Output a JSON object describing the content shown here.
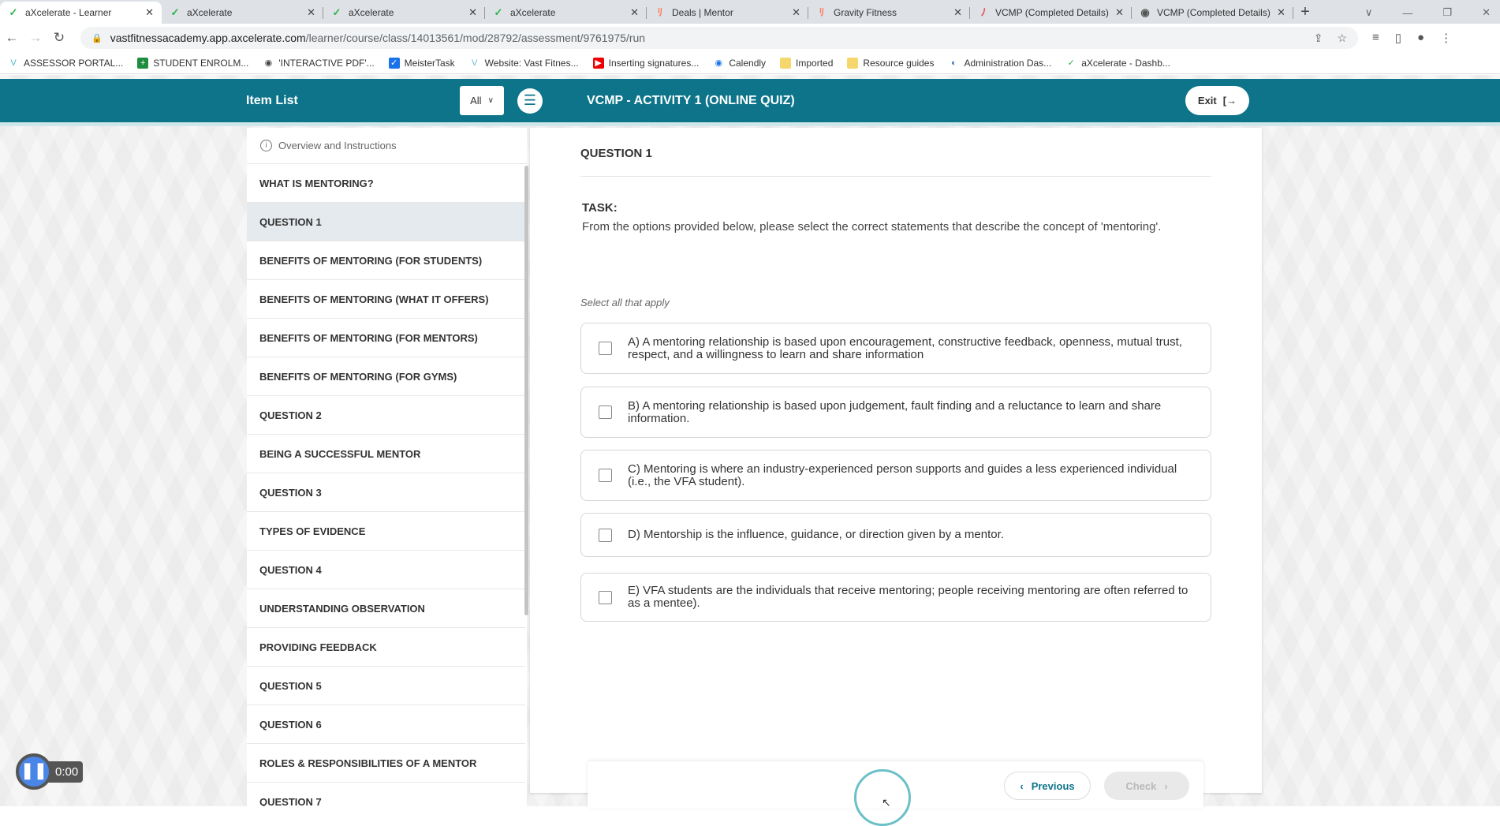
{
  "browser": {
    "tabs": [
      {
        "title": "aXcelerate - Learner",
        "icon": "axcelerate-icon",
        "active": true
      },
      {
        "title": "aXcelerate",
        "icon": "axcelerate-icon"
      },
      {
        "title": "aXcelerate",
        "icon": "axcelerate-icon"
      },
      {
        "title": "aXcelerate",
        "icon": "axcelerate-icon"
      },
      {
        "title": "Deals | Mentor",
        "icon": "hubspot-icon"
      },
      {
        "title": "Gravity Fitness",
        "icon": "hubspot-icon"
      },
      {
        "title": "VCMP (Completed Details)",
        "icon": "monday-icon"
      },
      {
        "title": "VCMP (Completed Details)",
        "icon": "globe-icon"
      }
    ],
    "url_host": "vastfitnessacademy.app.axcelerate.com",
    "url_path": "/learner/course/class/14013561/mod/28792/assessment/9761975/run",
    "bookmarks": [
      "ASSESSOR PORTAL...",
      "STUDENT ENROLM...",
      "'INTERACTIVE PDF'...",
      "MeisterTask",
      "Website: Vast Fitnes...",
      "Inserting signatures...",
      "Calendly",
      "Imported",
      "Resource guides",
      "Administration Das...",
      "aXcelerate - Dashb..."
    ]
  },
  "header": {
    "item_list": "Item List",
    "filter": "All",
    "title": "VCMP - ACTIVITY 1 (ONLINE QUIZ)",
    "exit": "Exit"
  },
  "sidebar": {
    "overview": "Overview and Instructions",
    "items": [
      "WHAT IS MENTORING?",
      "QUESTION 1",
      "BENEFITS OF MENTORING (FOR STUDENTS)",
      "BENEFITS OF MENTORING (WHAT IT OFFERS)",
      "BENEFITS OF MENTORING (FOR MENTORS)",
      "BENEFITS OF MENTORING (FOR GYMS)",
      "QUESTION 2",
      "BEING A SUCCESSFUL MENTOR",
      "QUESTION 3",
      "TYPES OF EVIDENCE",
      "QUESTION 4",
      "UNDERSTANDING OBSERVATION",
      "PROVIDING FEEDBACK",
      "QUESTION 5",
      "QUESTION 6",
      "ROLES & RESPONSIBILITIES OF A MENTOR",
      "QUESTION 7"
    ],
    "selected": "QUESTION 1"
  },
  "question": {
    "heading": "QUESTION 1",
    "task_label": "TASK:",
    "task_text": "From the options provided below, please select the correct statements that describe the concept of 'mentoring'.",
    "instruction": "Select all that apply",
    "options": [
      "A) A mentoring relationship is based upon encouragement, constructive feedback, openness, mutual trust, respect, and a willingness to learn and share information",
      "B) A mentoring relationship is based upon judgement, fault finding and a reluctance to learn and share information.",
      "C) Mentoring is where an industry-experienced person supports and guides a less experienced individual (i.e., the VFA student).",
      "D) Mentorship is the influence, guidance, or direction given by a mentor.",
      "E) VFA students are the individuals that receive mentoring; people receiving mentoring are often referred to as a mentee)."
    ]
  },
  "footer": {
    "previous": "Previous",
    "check": "Check"
  },
  "player": {
    "time": "0:00"
  },
  "colors": {
    "header": "#0d7489",
    "accent": "#0d7489"
  }
}
